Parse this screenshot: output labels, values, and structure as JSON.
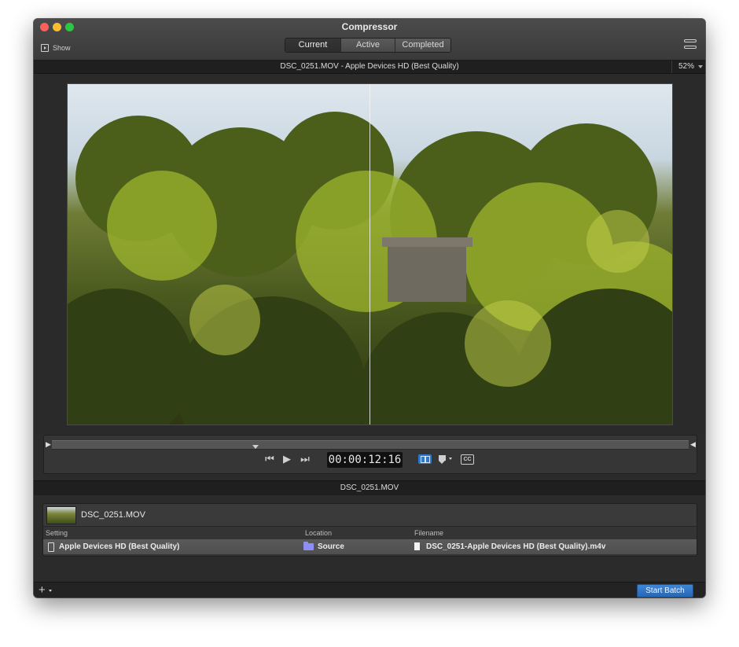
{
  "window": {
    "title": "Compressor",
    "show_label": "Show",
    "tabs": [
      {
        "label": "Current",
        "active": true
      },
      {
        "label": "Active",
        "active": false
      },
      {
        "label": "Completed",
        "active": false
      }
    ]
  },
  "preview": {
    "title": "DSC_0251.MOV - Apple Devices HD (Best Quality)",
    "zoom": "52%"
  },
  "transport": {
    "timecode": "00:00:12:16",
    "split_view_active": true,
    "icons": [
      "go-to-start-icon",
      "play-icon",
      "go-to-end-icon",
      "split-view-icon",
      "marker-icon",
      "closed-captions-icon"
    ]
  },
  "batch": {
    "header": "DSC_0251.MOV",
    "job_name": "DSC_0251.MOV",
    "columns": {
      "setting": "Setting",
      "location": "Location",
      "filename": "Filename"
    },
    "row": {
      "setting": "Apple Devices HD (Best Quality)",
      "location": "Source",
      "filename": "DSC_0251-Apple Devices HD (Best Quality).m4v"
    }
  },
  "footer": {
    "start_label": "Start Batch"
  },
  "colors": {
    "accent": "#2f79c9",
    "window_bg": "#2b2b2b",
    "folder": "#8d8ef6"
  }
}
